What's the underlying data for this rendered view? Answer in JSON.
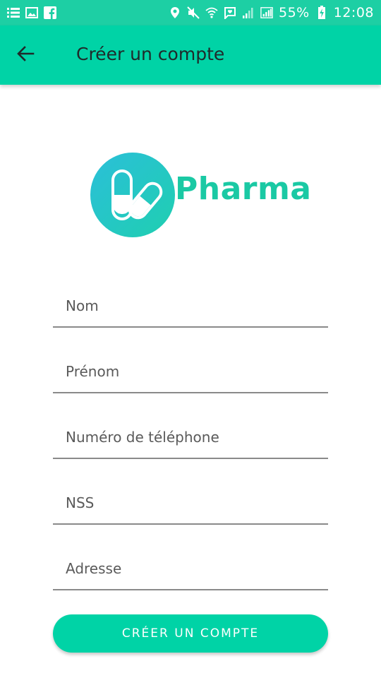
{
  "status_bar": {
    "left_icons": [
      "list-icon",
      "image-icon",
      "facebook-icon"
    ],
    "right_icons": [
      "location-icon",
      "mute-icon",
      "wifi-icon",
      "message-icon",
      "signal-icon",
      "signal-icon",
      "battery-icon"
    ],
    "battery": "55%",
    "time": "12:08"
  },
  "app_bar": {
    "title": "Créer un compte",
    "back_icon": "arrow-back-icon",
    "color": "#00d3a6"
  },
  "logo": {
    "text": "Pharma",
    "icon": "pill-icon",
    "color": "#1ac9a4"
  },
  "form": {
    "fields": [
      {
        "placeholder": "Nom",
        "value": ""
      },
      {
        "placeholder": "Prénom",
        "value": ""
      },
      {
        "placeholder": "Numéro de téléphone",
        "value": ""
      },
      {
        "placeholder": "NSS",
        "value": ""
      },
      {
        "placeholder": "Adresse",
        "value": ""
      }
    ],
    "submit_label": "CRÉER UN COMPTE"
  }
}
